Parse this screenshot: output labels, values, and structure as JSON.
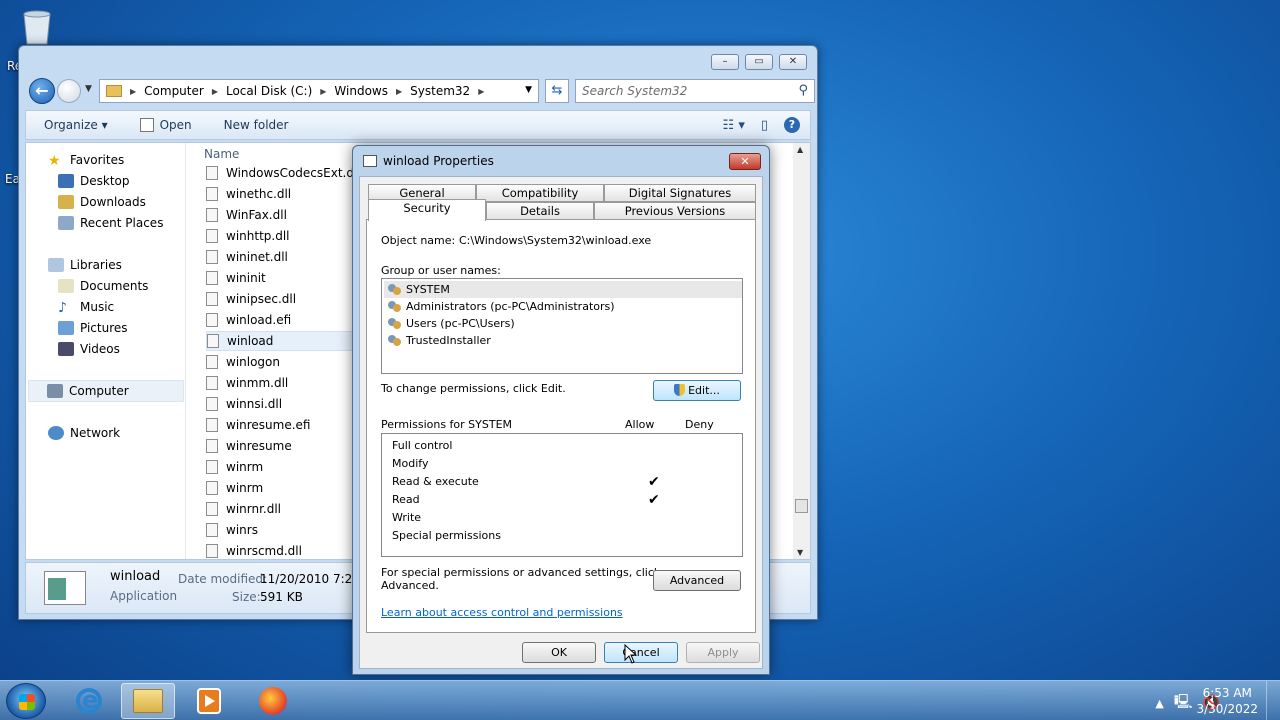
{
  "desktop": {
    "left_edge_labels": [
      "Re",
      "Ea"
    ]
  },
  "explorer": {
    "window_controls": [
      "–",
      "▭",
      "✕"
    ],
    "address": {
      "segments": [
        "Computer",
        "Local Disk (C:)",
        "Windows",
        "System32"
      ]
    },
    "search": {
      "placeholder": "Search System32"
    },
    "toolbar": {
      "organize": "Organize ▾",
      "open": "Open",
      "new_folder": "New folder"
    },
    "nav": {
      "favorites": "Favorites",
      "desktop": "Desktop",
      "downloads": "Downloads",
      "recent": "Recent Places",
      "libraries": "Libraries",
      "documents": "Documents",
      "music": "Music",
      "pictures": "Pictures",
      "videos": "Videos",
      "computer": "Computer",
      "network": "Network"
    },
    "column_name": "Name",
    "files": [
      "WindowsCodecsExt.dll",
      "winethc.dll",
      "WinFax.dll",
      "winhttp.dll",
      "wininet.dll",
      "wininit",
      "winipsec.dll",
      "winload.efi",
      "winload",
      "winlogon",
      "winmm.dll",
      "winnsi.dll",
      "winresume.efi",
      "winresume",
      "winrm",
      "winrm",
      "winrnr.dll",
      "winrs",
      "winrscmd.dll"
    ],
    "selected_file_index": 8,
    "details": {
      "name": "winload",
      "type": "Application",
      "modified_label": "Date modified:",
      "modified_value": "11/20/2010 7:24 PM",
      "size_label": "Size:",
      "size_value": "591 KB"
    }
  },
  "dialog": {
    "title": "winload Properties",
    "close": "✕",
    "tabs_row1": [
      "General",
      "Compatibility",
      "Digital Signatures"
    ],
    "tabs_row2": [
      "Security",
      "Details",
      "Previous Versions"
    ],
    "active_tab": "Security",
    "object_label": "Object name:",
    "object_value": "C:\\Windows\\System32\\winload.exe",
    "group_label": "Group or user names:",
    "users": [
      "SYSTEM",
      "Administrators (pc-PC\\Administrators)",
      "Users (pc-PC\\Users)",
      "TrustedInstaller"
    ],
    "selected_user": 0,
    "change_text": "To change permissions, click Edit.",
    "edit_button": "Edit...",
    "permissions_label": "Permissions for SYSTEM",
    "allow_label": "Allow",
    "deny_label": "Deny",
    "permissions": [
      {
        "name": "Full control",
        "allow": false
      },
      {
        "name": "Modify",
        "allow": false
      },
      {
        "name": "Read & execute",
        "allow": true
      },
      {
        "name": "Read",
        "allow": true
      },
      {
        "name": "Write",
        "allow": false
      },
      {
        "name": "Special permissions",
        "allow": false
      }
    ],
    "advanced_text_1": "For special permissions or advanced settings, click",
    "advanced_text_2": "Advanced.",
    "advanced_button": "Advanced",
    "learn_link": "Learn about access control and permissions",
    "ok": "OK",
    "cancel": "Cancel",
    "apply": "Apply"
  },
  "taskbar": {
    "clock_time": "6:53 AM",
    "clock_date": "3/30/2022",
    "tray_arrow": "▲"
  }
}
